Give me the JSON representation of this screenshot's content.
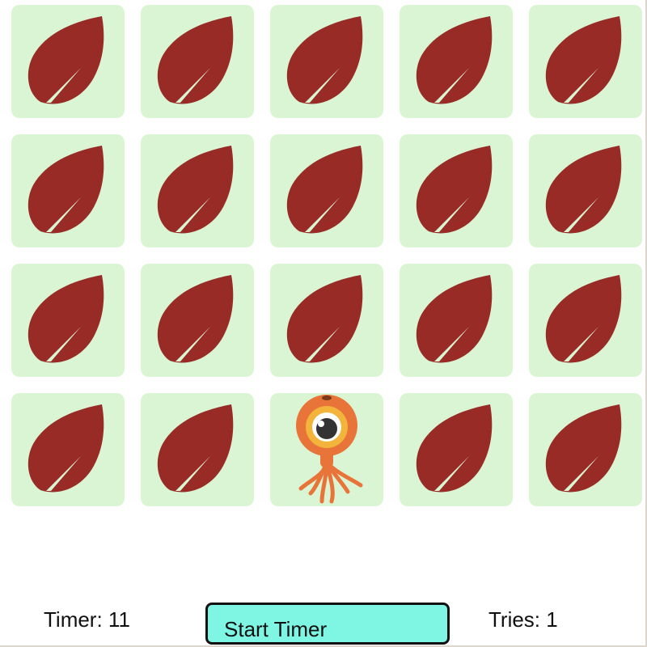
{
  "colors": {
    "tile_bg": "#daf5d4",
    "leaf": "#992b26",
    "button_bg": "#7ff5e3",
    "monster_body": "#e8743a"
  },
  "board": {
    "columns": 5,
    "rows": 4,
    "tiles": [
      {
        "state": "face-down",
        "icon": "leaf-icon"
      },
      {
        "state": "face-down",
        "icon": "leaf-icon"
      },
      {
        "state": "face-down",
        "icon": "leaf-icon"
      },
      {
        "state": "face-down",
        "icon": "leaf-icon"
      },
      {
        "state": "face-down",
        "icon": "leaf-icon"
      },
      {
        "state": "face-down",
        "icon": "leaf-icon"
      },
      {
        "state": "face-down",
        "icon": "leaf-icon"
      },
      {
        "state": "face-down",
        "icon": "leaf-icon"
      },
      {
        "state": "face-down",
        "icon": "leaf-icon"
      },
      {
        "state": "face-down",
        "icon": "leaf-icon"
      },
      {
        "state": "face-down",
        "icon": "leaf-icon"
      },
      {
        "state": "face-down",
        "icon": "leaf-icon"
      },
      {
        "state": "face-down",
        "icon": "leaf-icon"
      },
      {
        "state": "face-down",
        "icon": "leaf-icon"
      },
      {
        "state": "face-down",
        "icon": "leaf-icon"
      },
      {
        "state": "face-down",
        "icon": "leaf-icon"
      },
      {
        "state": "face-down",
        "icon": "leaf-icon"
      },
      {
        "state": "face-up",
        "icon": "one-eyed-octopus-monster-icon"
      },
      {
        "state": "face-down",
        "icon": "leaf-icon"
      },
      {
        "state": "face-down",
        "icon": "leaf-icon"
      }
    ]
  },
  "footer": {
    "timer_text": "Timer: 11",
    "start_button_label": "Start Timer",
    "tries_text": "Tries: 1"
  }
}
